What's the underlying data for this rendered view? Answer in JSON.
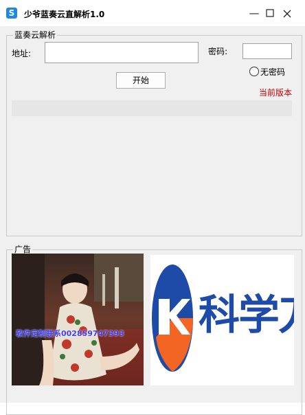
{
  "window": {
    "title": "少爷蓝奏云直解析1.0",
    "icon": "s-app-icon",
    "minimize_glyph": "—",
    "maximize_glyph": "☐",
    "close_glyph": "✕"
  },
  "parse_group": {
    "legend": "蓝奏云解析",
    "address_label": "地址:",
    "address_value": "",
    "password_label": "密码:",
    "password_value": "",
    "start_button": "开始",
    "no_password_radio": "无密码",
    "no_password_checked": false,
    "version_link": "当前版本",
    "progress": 0
  },
  "ad_group": {
    "legend": "广告",
    "ad_text": "软件定制联系002859747393",
    "logo_text": "科学刀"
  },
  "colors": {
    "link_red": "#c00000",
    "app_icon_blue": "#1e88e5",
    "logo_blue": "#1f4ba8",
    "logo_orange": "#f26522"
  }
}
